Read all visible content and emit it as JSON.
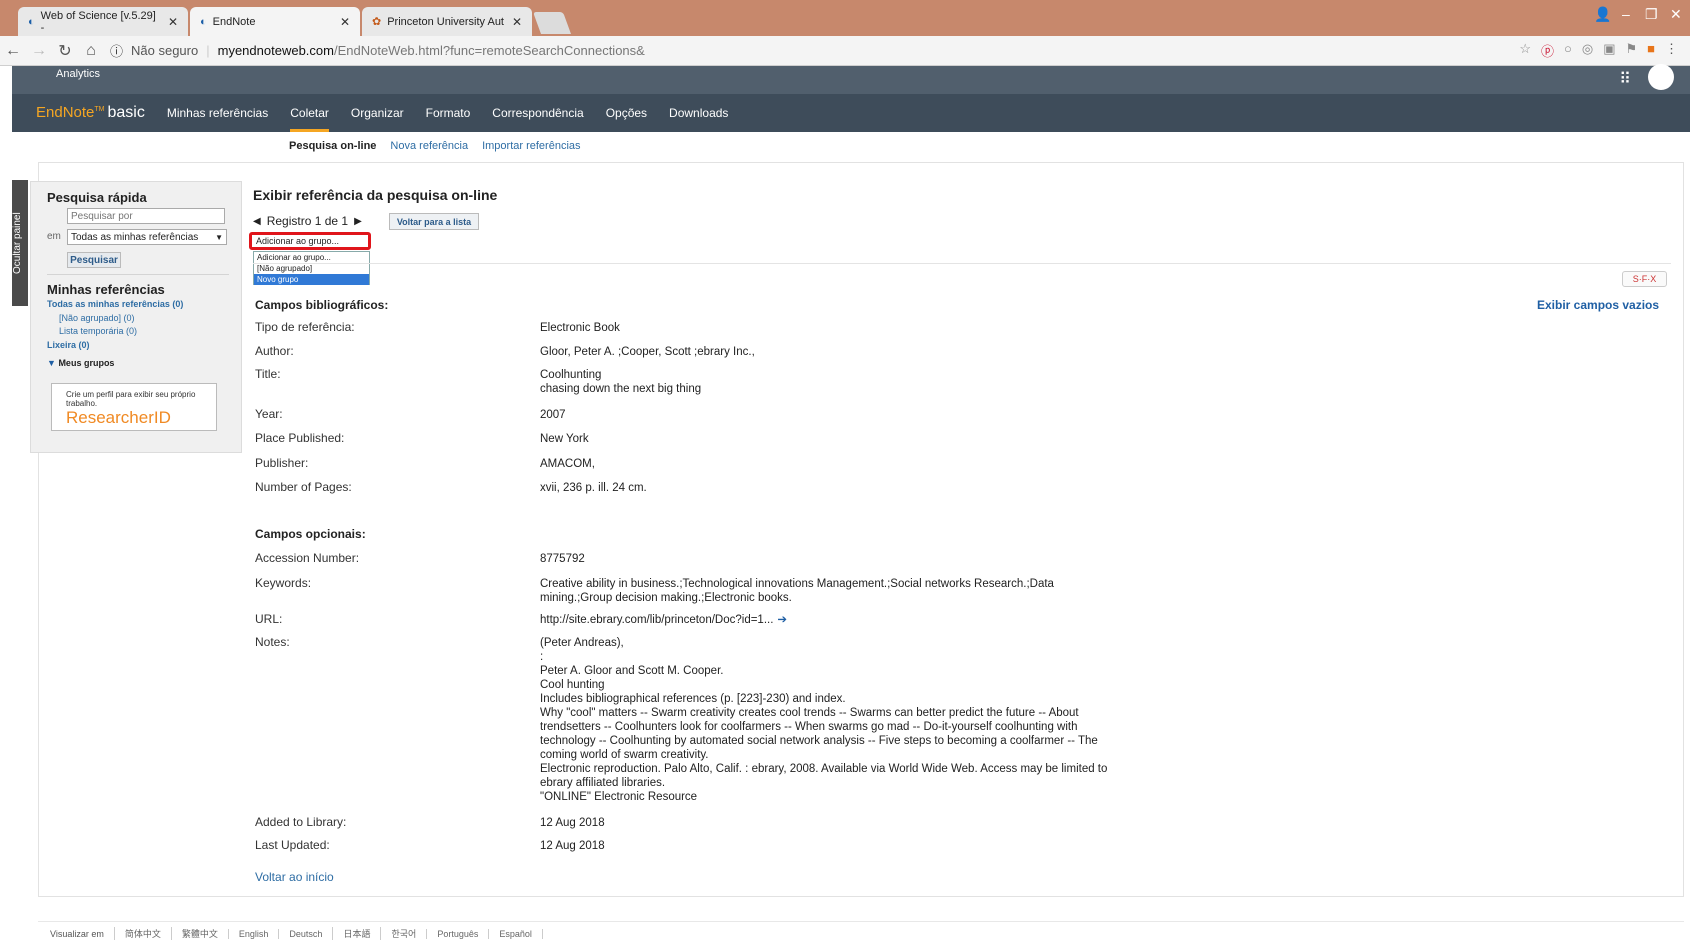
{
  "browser": {
    "tabs": [
      {
        "title": "Web of Science [v.5.29] -"
      },
      {
        "title": "EndNote"
      },
      {
        "title": "Princeton University Aut"
      }
    ],
    "security": "Não seguro",
    "url_host": "myendnoteweb.com",
    "url_path": "/EndNoteWeb.html?func=remoteSearchConnections&"
  },
  "brand": {
    "analytics": "Analytics"
  },
  "menu": {
    "logo": "EndNote",
    "logo_sup": "TM",
    "logo_basic": "basic",
    "items": [
      "Minhas referências",
      "Coletar",
      "Organizar",
      "Formato",
      "Correspondência",
      "Opções",
      "Downloads"
    ]
  },
  "submenu": {
    "current": "Pesquisa on-line",
    "items": [
      "Nova referência",
      "Importar referências"
    ]
  },
  "side_tab": "Ocultar painel",
  "sidebar": {
    "quick_title": "Pesquisa rápida",
    "search_placeholder": "Pesquisar por",
    "em": "em",
    "scope": "Todas as minhas referências",
    "search_btn": "Pesquisar",
    "refs_title": "Minhas referências",
    "all_refs": "Todas as minhas referências (0)",
    "ungrouped": "[Não agrupado] (0)",
    "temp_list": "Lista temporária (0)",
    "trash": "Lixeira (0)",
    "my_groups": "Meus grupos",
    "researcher_text": "Crie um perfil para exibir seu próprio trabalho.",
    "researcher_logo": "ResearcherID"
  },
  "record": {
    "title": "Exibir referência da pesquisa on-line",
    "nav": "Registro 1 de 1",
    "back_list": "Voltar para a lista",
    "group_select": "Adicionar ao grupo...",
    "group_options": [
      "Adicionar ao grupo...",
      "[Não agrupado]",
      "Novo grupo"
    ],
    "sfx": "S·F·X",
    "show_empty": "Exibir campos vazios",
    "bib_section": "Campos bibliográficos:",
    "opt_section": "Campos opcionais:",
    "fields": {
      "ref_type_l": "Tipo de referência:",
      "ref_type": "Electronic Book",
      "author_l": "Author:",
      "author": "Gloor, Peter A. ;Cooper, Scott ;ebrary Inc.,",
      "title_l": "Title:",
      "title": "Coolhunting\nchasing down the next big thing",
      "year_l": "Year:",
      "year": "2007",
      "place_l": "Place Published:",
      "place": "New York",
      "publisher_l": "Publisher:",
      "publisher": "AMACOM,",
      "pages_l": "Number of Pages:",
      "pages": "xvii, 236 p. ill. 24 cm.",
      "accession_l": "Accession Number:",
      "accession": "8775792",
      "keywords_l": "Keywords:",
      "keywords": "Creative ability in business.;Technological innovations Management.;Social networks Research.;Data\nmining.;Group decision making.;Electronic books.",
      "url_l": "URL:",
      "url": "http://site.ebrary.com/lib/princeton/Doc?id=1...",
      "notes_l": "Notes:",
      "notes": "(Peter Andreas),\n:\nPeter A. Gloor and Scott M. Cooper.\nCool hunting\nIncludes bibliographical references (p. [223]-230) and index.\nWhy \"cool\" matters -- Swarm creativity creates cool trends -- Swarms can better predict the future -- About\ntrendsetters -- Coolhunters look for coolfarmers -- When swarms go mad -- Do-it-yourself coolhunting with\ntechnology -- Coolhunting by automated social network analysis -- Five steps to becoming a coolfarmer -- The\ncoming world of swarm creativity.\nElectronic reproduction. Palo Alto, Calif. : ebrary, 2008. Available via World Wide Web. Access may be limited to\nebrary affiliated libraries.\n\"ONLINE\" Electronic Resource",
      "added_l": "Added to Library:",
      "added": "12 Aug 2018",
      "updated_l": "Last Updated:",
      "updated": "12 Aug 2018"
    },
    "back_top": "Voltar ao início"
  },
  "footer": {
    "label": "Visualizar em",
    "languages": [
      "简体中文",
      "繁體中文",
      "English",
      "Deutsch",
      "日本語",
      "한국어",
      "Português",
      "Español"
    ]
  }
}
